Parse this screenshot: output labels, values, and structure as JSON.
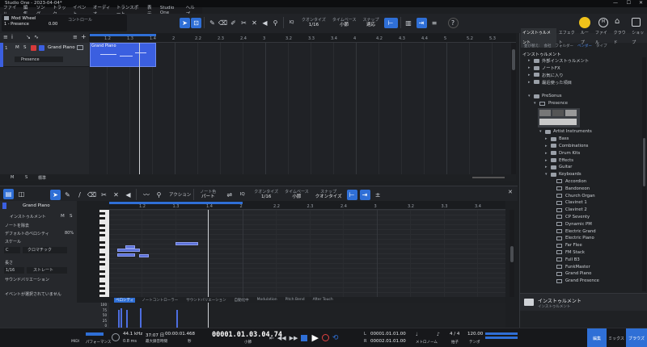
{
  "window": {
    "title": "Studio One - 2023-04-04*"
  },
  "menu": [
    "ファイル",
    "編集",
    "ソング",
    "トラック",
    "イベント",
    "オーディオ",
    "トランスポート",
    "表示",
    "Studio One",
    "ヘルプ"
  ],
  "top_left": {
    "control_label": "Mod Wheel",
    "track_label": "1 - Presence",
    "value": "0.00",
    "knob_label": "コントロール"
  },
  "toolbar": {
    "quantize_label": "クオンタイズ",
    "quantize_value": "1/16",
    "timebase_label": "タイムベース",
    "timebase_value": "小節",
    "snap_label": "スナップ",
    "snap_value": "適応",
    "iq": "IQ",
    "help": "?"
  },
  "tracks": [
    {
      "num": "1",
      "name": "Grand Piano",
      "m": "M",
      "s": "S",
      "preset": "Presence"
    }
  ],
  "arrange": {
    "ruler": [
      "1.2",
      "1.3",
      "1.4",
      "2",
      "2.2",
      "2.3",
      "2.4",
      "3",
      "3.2",
      "3.3",
      "3.4",
      "4",
      "4.2",
      "4.3",
      "4.4",
      "5",
      "5.2",
      "5.3",
      "5.4",
      "6",
      "6.2",
      "6.3",
      "6.4",
      "7",
      "7.2",
      "7.3",
      "7.4",
      "8",
      "8.2",
      "8.3",
      "8.4",
      "9",
      "9.2",
      "9.3",
      "9.4",
      "10",
      "10.2",
      "10.3",
      "10.4"
    ],
    "clip_name": "Grand Piano",
    "footer_m": "M",
    "footer_s": "S",
    "footer_std": "標準"
  },
  "editor": {
    "toolbar": {
      "action_label": "アクション",
      "note_color_label": "ノート色",
      "note_color_value": "パート",
      "iq": "IQ",
      "quantize_label": "クオンタイズ",
      "quantize_value": "1/16",
      "timebase_label": "タイムベース",
      "timebase_value": "小節",
      "snap_label": "スナップ",
      "snap_value": "クオンタイズ"
    },
    "track_name": "Grand Piano",
    "inst_label": "インストゥルメント",
    "m": "M",
    "s": "S",
    "rows": [
      {
        "label": "ノートを除去",
        "value": ""
      },
      {
        "label": "デフォルトのベロシティ",
        "value": "80%"
      },
      {
        "label": "スケール",
        "value": ""
      }
    ],
    "scale_key": "C",
    "scale_type": "クロマチック",
    "length_label": "長さ",
    "length_value": "1/16",
    "length_type": "ストレート",
    "sound_var_label": "サウンドバリエーション",
    "no_event": "イベントが選択されていません",
    "ruler": [
      "1.2",
      "1.3",
      "1.4",
      "2",
      "2.2",
      "2.3",
      "2.4",
      "3",
      "3.2",
      "3.3",
      "3.4",
      "4",
      "4.2",
      "4.3",
      "4.4",
      "5"
    ],
    "lane_tabs": [
      "ベロシティ",
      "ノートコントローラー",
      "サウンドバリエーション",
      "自動化中",
      "Modulation",
      "Pitch Bend",
      "After Touch"
    ],
    "vel_scale": [
      "100",
      "75",
      "50",
      "25",
      "0"
    ]
  },
  "browser": {
    "tabs": [
      "インストゥルメント",
      "エフェクト",
      "ループ",
      "ファイル",
      "クラウド",
      "ショップ"
    ],
    "sub_tabs": [
      "並び替え:",
      "会社",
      "フォルダー",
      "ベンダー",
      "タイプ"
    ],
    "header": "インストゥルメント",
    "items": [
      {
        "indent": 0,
        "tri": "▸",
        "icon": "folder",
        "label": "外部インストゥルメント"
      },
      {
        "indent": 0,
        "tri": "▸",
        "icon": "folder",
        "label": "ノートFX"
      },
      {
        "indent": 0,
        "tri": "▸",
        "icon": "folder",
        "label": "お気に入り"
      },
      {
        "indent": 0,
        "tri": "▸",
        "icon": "folder",
        "label": "最近使った項目"
      },
      {
        "indent": 0,
        "tri": "",
        "icon": "",
        "label": ""
      },
      {
        "indent": 0,
        "tri": "▾",
        "icon": "folder",
        "label": "PreSonus"
      },
      {
        "indent": 1,
        "tri": "▾",
        "icon": "kb",
        "label": "Presence"
      },
      {
        "indent": 0,
        "tri": "",
        "icon": "",
        "label": ""
      },
      {
        "indent": 0,
        "tri": "",
        "icon": "",
        "label": ""
      },
      {
        "indent": 0,
        "tri": "",
        "icon": "",
        "label": ""
      },
      {
        "indent": 2,
        "tri": "▾",
        "icon": "folder",
        "label": "Artist Instruments"
      },
      {
        "indent": 3,
        "tri": "▸",
        "icon": "folder",
        "label": "Bass"
      },
      {
        "indent": 3,
        "tri": "▸",
        "icon": "folder",
        "label": "Combinations"
      },
      {
        "indent": 3,
        "tri": "▸",
        "icon": "folder",
        "label": "Drum Kits"
      },
      {
        "indent": 3,
        "tri": "▸",
        "icon": "folder",
        "label": "Effects"
      },
      {
        "indent": 3,
        "tri": "▸",
        "icon": "folder",
        "label": "Guitar"
      },
      {
        "indent": 3,
        "tri": "▾",
        "icon": "folder",
        "label": "Keyboards"
      },
      {
        "indent": 4,
        "tri": "",
        "icon": "kb",
        "label": "Accordion"
      },
      {
        "indent": 4,
        "tri": "",
        "icon": "kb",
        "label": "Bandoneon"
      },
      {
        "indent": 4,
        "tri": "",
        "icon": "kb",
        "label": "Church Organ"
      },
      {
        "indent": 4,
        "tri": "",
        "icon": "kb",
        "label": "Clavinet 1"
      },
      {
        "indent": 4,
        "tri": "",
        "icon": "kb",
        "label": "Clavinet 2"
      },
      {
        "indent": 4,
        "tri": "",
        "icon": "kb",
        "label": "CP Seventy"
      },
      {
        "indent": 4,
        "tri": "",
        "icon": "kb",
        "label": "Dynamic PM"
      },
      {
        "indent": 4,
        "tri": "",
        "icon": "kb",
        "label": "Electric Grand"
      },
      {
        "indent": 4,
        "tri": "",
        "icon": "kb",
        "label": "Electric Piano"
      },
      {
        "indent": 4,
        "tri": "",
        "icon": "kb",
        "label": "Far Flee"
      },
      {
        "indent": 4,
        "tri": "",
        "icon": "kb",
        "label": "FM Stack"
      },
      {
        "indent": 4,
        "tri": "",
        "icon": "kb",
        "label": "Full B3"
      },
      {
        "indent": 4,
        "tri": "",
        "icon": "kb",
        "label": "FunkMaster"
      },
      {
        "indent": 4,
        "tri": "",
        "icon": "kb",
        "label": "Grand Piano"
      },
      {
        "indent": 4,
        "tri": "",
        "icon": "kb",
        "label": "Grand Presence"
      }
    ],
    "footer_title": "インストゥルメント",
    "footer_sub": "インストゥルメント"
  },
  "transport": {
    "midi_label": "MIDI",
    "perf_label": "パフォーマンス",
    "sample_rate": "44.1 kHz",
    "latency": "0.8 ms",
    "time_sec": "00:00:01.468",
    "time_sub": "37:07 日",
    "time_sub2": "最大録音時間",
    "time_sec_label": "秒",
    "position": "00001.01.03.04.74",
    "position_label": "小節",
    "loop_l": "00001.01.01.00",
    "loop_r": "00002.01.01.00",
    "l_label": "L",
    "r_label": "R",
    "metronome": "メトロノーム",
    "timesig": "4 / 4",
    "timesig_label": "拍子",
    "tempo": "120.00",
    "tempo_label": "テンポ",
    "btn_edit": "編集",
    "btn_mix": "ミックス",
    "btn_browse": "ブラウズ"
  },
  "colors": {
    "accent": "#2f6fd6",
    "clip": "#3b5fe0",
    "note": "#5a6fd8"
  }
}
